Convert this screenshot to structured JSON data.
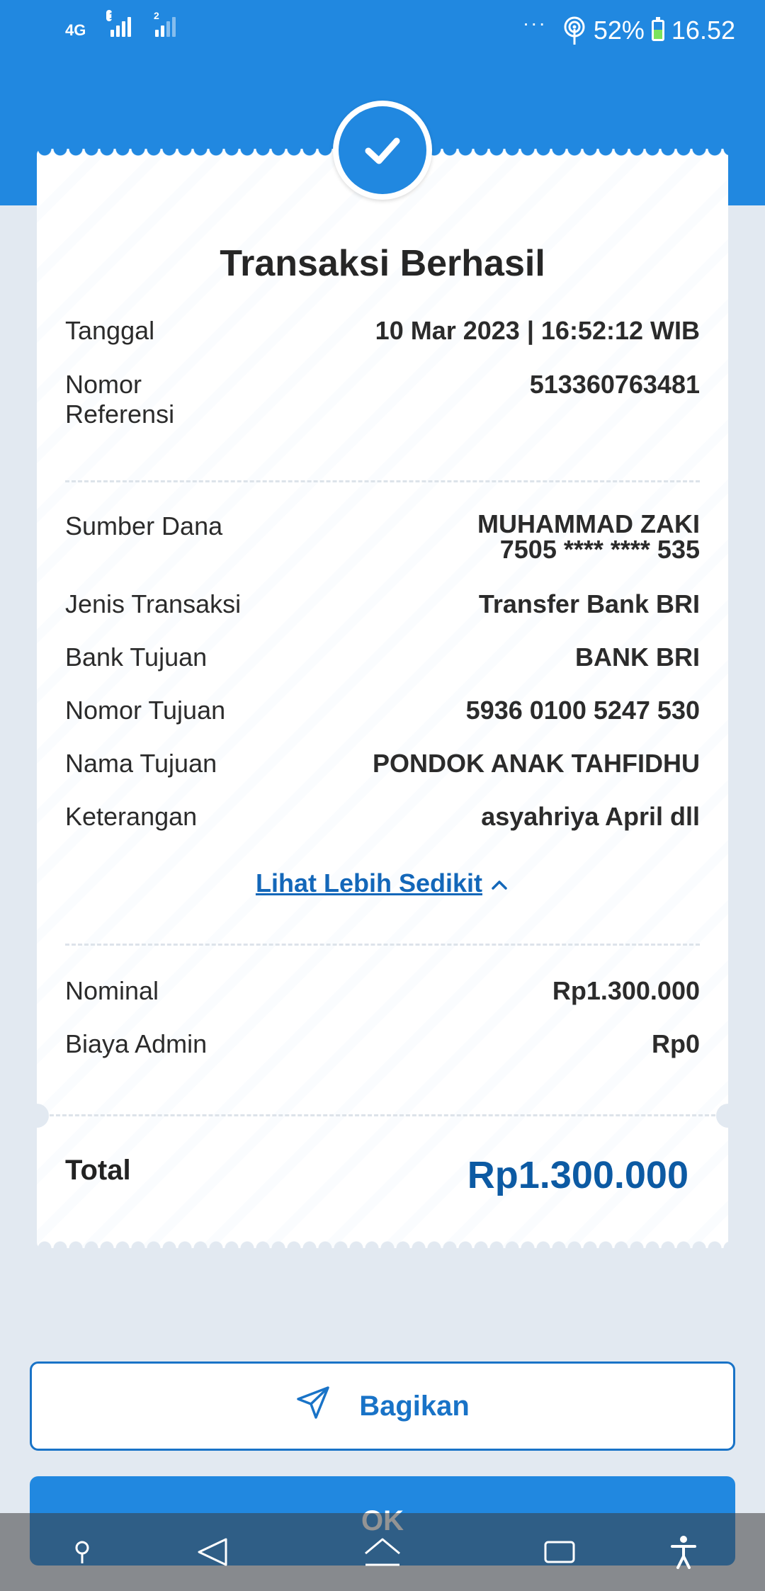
{
  "status_bar": {
    "network_type": "4G",
    "sim1_tag": "1",
    "sim2_tag": "2",
    "dots": "···",
    "battery": "52%",
    "time": "16.52"
  },
  "receipt": {
    "title": "Transaksi Berhasil",
    "date_label": "Tanggal",
    "date_value": "10 Mar 2023 | 16:52:12 WIB",
    "ref_label_line1": "Nomor",
    "ref_label_line2": "Referensi",
    "ref_value": "513360763481",
    "source_label": "Sumber Dana",
    "source_name": "MUHAMMAD ZAKI",
    "source_account": "7505 **** **** 535",
    "type_label": "Jenis Transaksi",
    "type_value": "Transfer Bank BRI",
    "bank_label": "Bank Tujuan",
    "bank_value": "BANK BRI",
    "dest_number_label": "Nomor Tujuan",
    "dest_number_value": "5936 0100 5247 530",
    "dest_name_label": "Nama Tujuan",
    "dest_name_value": "PONDOK ANAK TAHFIDHU",
    "note_label": "Keterangan",
    "note_value": "asyahriya April dll",
    "toggle_label": "Lihat Lebih Sedikit",
    "nominal_label": "Nominal",
    "nominal_value": "Rp1.300.000",
    "fee_label": "Biaya Admin",
    "fee_value": "Rp0",
    "total_label": "Total",
    "total_value": "Rp1.300.000"
  },
  "actions": {
    "share_label": "Bagikan",
    "ok_label": "OK"
  },
  "colors": {
    "primary": "#2188e0",
    "total_text": "#0c5aa3",
    "link": "#1367b9",
    "background": "#e2e9f1"
  },
  "icons": {
    "success": "check-icon",
    "share": "send-icon",
    "toggle": "chevron-up-icon"
  }
}
